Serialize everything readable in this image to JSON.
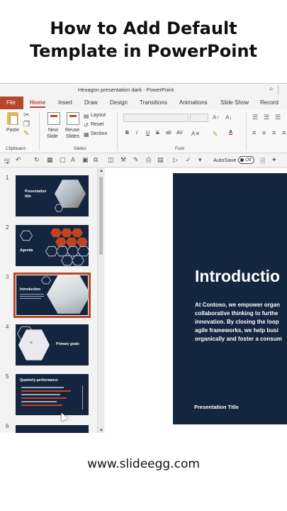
{
  "headline": {
    "line1": "How to Add Default",
    "line2": "Template in PowerPoint"
  },
  "window": {
    "title": "Hexagon presentation dark  -  PowerPoint"
  },
  "colors": {
    "accent": "#b7472a",
    "slide_bg": "#14253f",
    "hex_orange": "#c0441f"
  },
  "tabs": [
    "File",
    "Home",
    "Insert",
    "Draw",
    "Design",
    "Transitions",
    "Animations",
    "Slide Show",
    "Record"
  ],
  "active_tab": "Home",
  "ribbon": {
    "paste": "Paste",
    "clipboard_group": "Clipboard",
    "new_slide_1": "New",
    "new_slide_2": "Slide",
    "reuse_slides_1": "Reuse",
    "reuse_slides_2": "Slides",
    "layout": "Layout",
    "reset": "Reset",
    "section": "Section",
    "slides_group": "Slides",
    "font_group": "Font",
    "bold": "B",
    "italic": "I",
    "underline": "U",
    "strike": "S",
    "case": "ab",
    "font_size_glyph": "AV"
  },
  "qat": {
    "autosave_label": "AutoSave",
    "autosave_state": "Off"
  },
  "thumbnails": [
    {
      "number": "1",
      "title_line1": "Presentation",
      "title_line2": "title"
    },
    {
      "number": "2",
      "title": "Agenda"
    },
    {
      "number": "3",
      "title": "Introduction"
    },
    {
      "number": "4",
      "title": "Primary goals"
    },
    {
      "number": "5",
      "title": "Quarterly performance"
    },
    {
      "number": "6"
    }
  ],
  "selected_slide": 3,
  "main_slide": {
    "heading": "Introductio",
    "body_lines": [
      "At Contoso, we empower organ",
      "collaborative thinking to furthe",
      "innovation. By closing the loop",
      "agile frameworks, we help busi",
      "organically and foster a consum"
    ],
    "footer": "Presentation Title"
  },
  "footer_url": "www.slideegg.com"
}
